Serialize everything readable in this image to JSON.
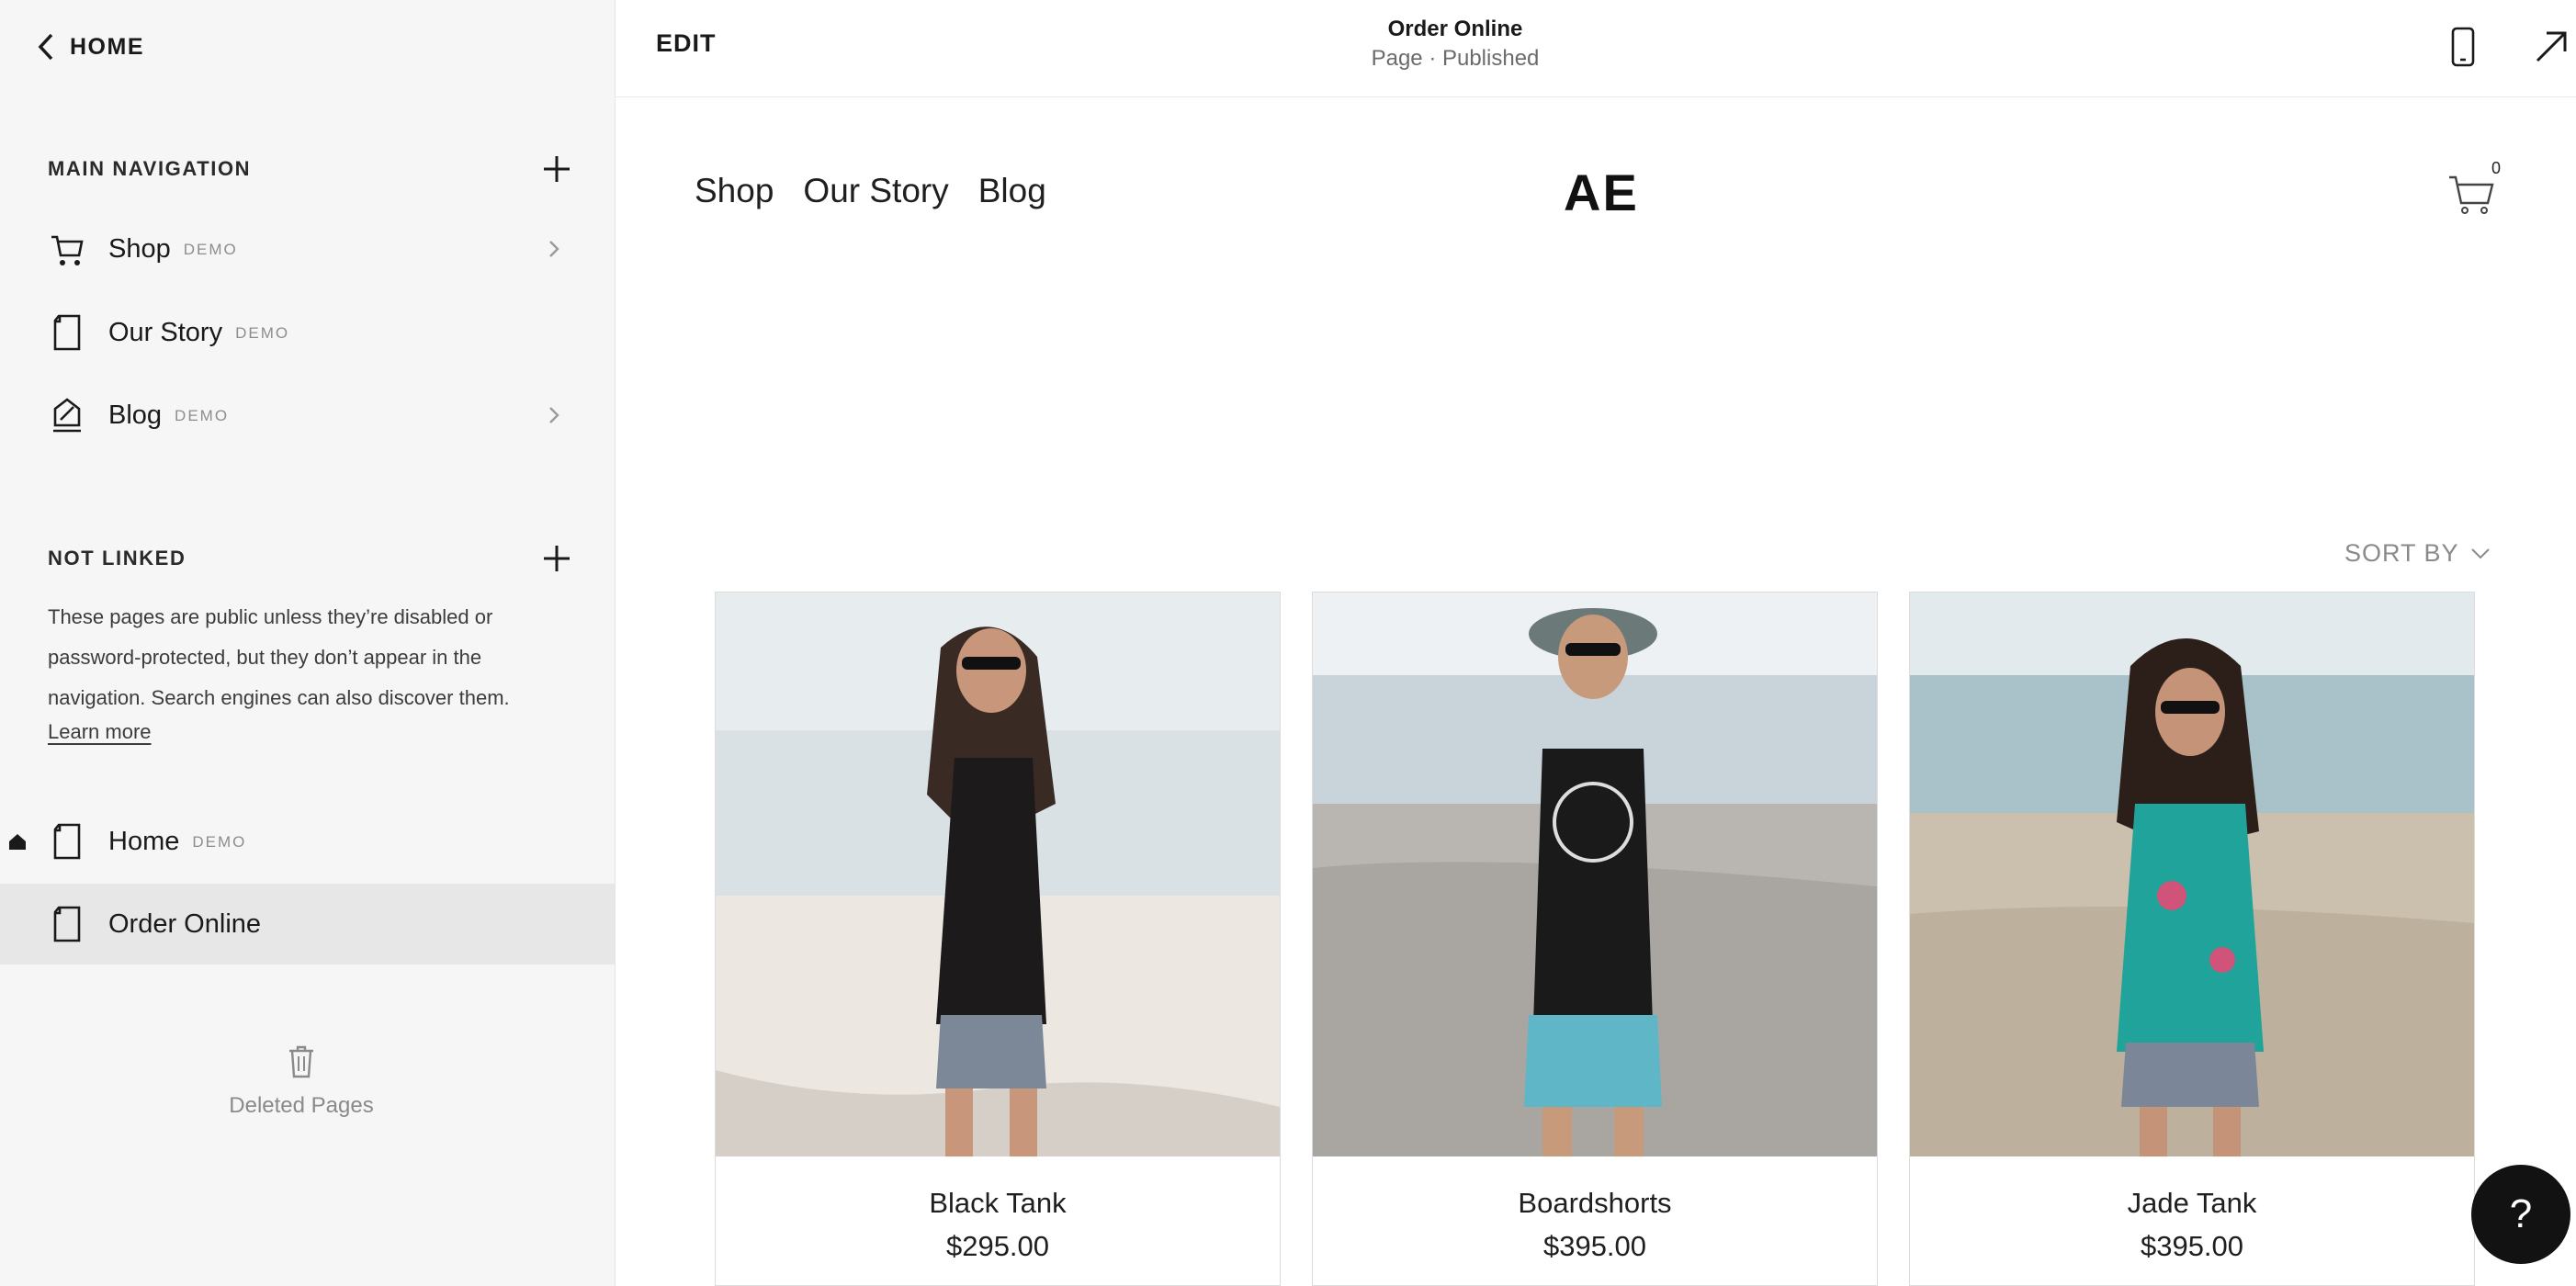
{
  "sidebar": {
    "back_label": "HOME",
    "main_nav": {
      "title": "MAIN NAVIGATION",
      "items": [
        {
          "label": "Shop",
          "tag": "DEMO"
        },
        {
          "label": "Our Story",
          "tag": "DEMO"
        },
        {
          "label": "Blog",
          "tag": "DEMO"
        }
      ]
    },
    "not_linked": {
      "title": "NOT LINKED",
      "description": "These pages are public unless they’re disabled or password-protected, but they don’t appear in the navigation. Search engines can also discover them.",
      "learn_more": "Learn more",
      "items": [
        {
          "label": "Home",
          "tag": "DEMO"
        },
        {
          "label": "Order Online",
          "tag": ""
        }
      ]
    },
    "deleted_label": "Deleted Pages"
  },
  "topbar": {
    "edit_label": "EDIT",
    "page_title": "Order Online",
    "page_status": "Page · Published"
  },
  "site": {
    "nav": [
      "Shop",
      "Our Story",
      "Blog"
    ],
    "logo": "AE",
    "cart_count": "0",
    "sort_label": "SORT BY",
    "products": [
      {
        "name": "Black Tank",
        "price": "$295.00"
      },
      {
        "name": "Boardshorts",
        "price": "$395.00"
      },
      {
        "name": "Jade Tank",
        "price": "$395.00"
      }
    ]
  },
  "help_label": "?",
  "colors": {
    "sidebar_bg": "#f6f6f6",
    "selected_bg": "#e7e7e7",
    "help_button": "#121212"
  }
}
